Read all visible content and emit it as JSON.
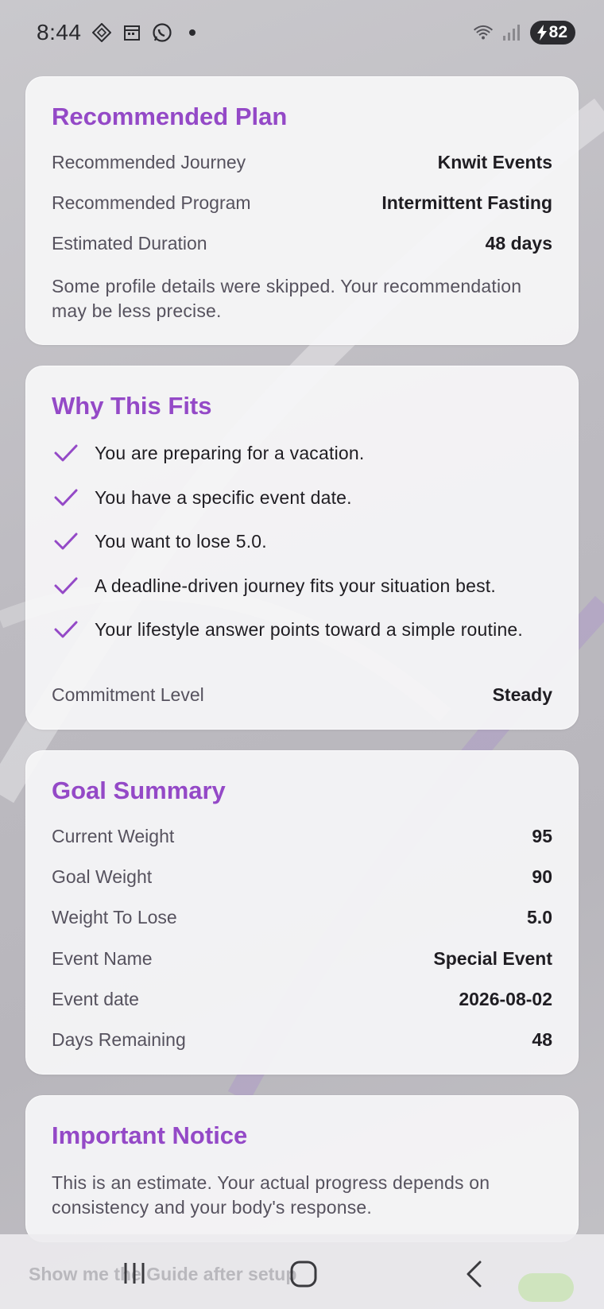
{
  "status_bar": {
    "time": "8:44",
    "battery": "82",
    "icons": [
      "diamond-app-icon",
      "calendar-icon",
      "whatsapp-icon",
      "dot-icon",
      "wifi-icon",
      "signal-icon",
      "battery-charging-icon"
    ]
  },
  "accent_color": "#9449c7",
  "recommended_plan": {
    "title": "Recommended Plan",
    "rows": [
      {
        "label": "Recommended Journey",
        "value": "Knwit Events"
      },
      {
        "label": "Recommended Program",
        "value": "Intermittent Fasting"
      },
      {
        "label": "Estimated Duration",
        "value": "48 days"
      }
    ],
    "note": "Some profile details were skipped. Your recommendation may be less precise."
  },
  "why_this_fits": {
    "title": "Why This Fits",
    "reasons": [
      "You are preparing for a vacation.",
      "You have a specific event date.",
      "You want to lose 5.0.",
      "A deadline-driven journey fits your situation best.",
      "Your lifestyle answer points toward a simple routine."
    ],
    "commitment": {
      "label": "Commitment Level",
      "value": "Steady"
    }
  },
  "goal_summary": {
    "title": "Goal Summary",
    "rows": [
      {
        "label": "Current Weight",
        "value": "95"
      },
      {
        "label": "Goal Weight",
        "value": "90"
      },
      {
        "label": "Weight To Lose",
        "value": "5.0"
      },
      {
        "label": "Event Name",
        "value": "Special Event"
      },
      {
        "label": "Event date",
        "value": "2026-08-02"
      },
      {
        "label": "Days Remaining",
        "value": "48"
      }
    ]
  },
  "important_notice": {
    "title": "Important Notice",
    "text": "This is an estimate. Your actual progress depends on consistency and your body's response."
  },
  "bottom": {
    "guide_label": "Show me the Guide after setup"
  }
}
